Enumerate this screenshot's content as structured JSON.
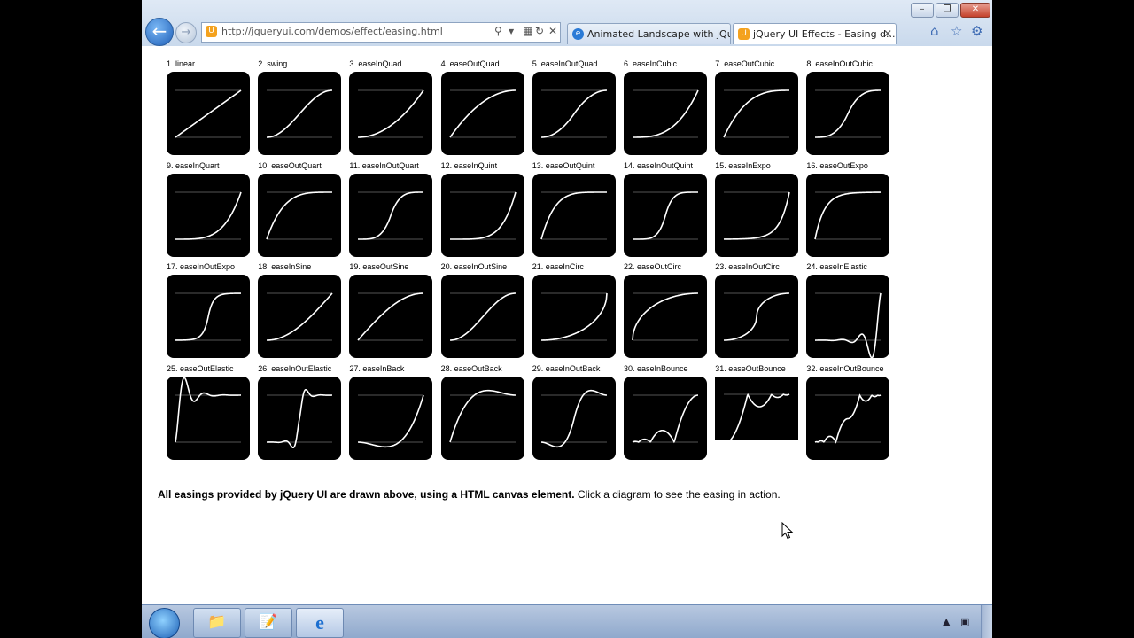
{
  "browser": {
    "address_url": "http://jqueryui.com/demos/effect/easing.html",
    "tabs": [
      {
        "label": "Animated Landscape with jQu..."
      },
      {
        "label": "jQuery UI Effects - Easing d..."
      }
    ]
  },
  "easings": [
    {
      "label": "1. linear",
      "name": "linear"
    },
    {
      "label": "2. swing",
      "name": "swing"
    },
    {
      "label": "3. easeInQuad",
      "name": "easeInQuad"
    },
    {
      "label": "4. easeOutQuad",
      "name": "easeOutQuad"
    },
    {
      "label": "5. easeInOutQuad",
      "name": "easeInOutQuad"
    },
    {
      "label": "6. easeInCubic",
      "name": "easeInCubic"
    },
    {
      "label": "7. easeOutCubic",
      "name": "easeOutCubic"
    },
    {
      "label": "8. easeInOutCubic",
      "name": "easeInOutCubic"
    },
    {
      "label": "9. easeInQuart",
      "name": "easeInQuart"
    },
    {
      "label": "10. easeOutQuart",
      "name": "easeOutQuart"
    },
    {
      "label": "11. easeInOutQuart",
      "name": "easeInOutQuart"
    },
    {
      "label": "12. easeInQuint",
      "name": "easeInQuint"
    },
    {
      "label": "13. easeOutQuint",
      "name": "easeOutQuint"
    },
    {
      "label": "14. easeInOutQuint",
      "name": "easeInOutQuint"
    },
    {
      "label": "15. easeInExpo",
      "name": "easeInExpo"
    },
    {
      "label": "16. easeOutExpo",
      "name": "easeOutExpo"
    },
    {
      "label": "17. easeInOutExpo",
      "name": "easeInOutExpo"
    },
    {
      "label": "18. easeInSine",
      "name": "easeInSine"
    },
    {
      "label": "19. easeOutSine",
      "name": "easeOutSine"
    },
    {
      "label": "20. easeInOutSine",
      "name": "easeInOutSine"
    },
    {
      "label": "21. easeInCirc",
      "name": "easeInCirc"
    },
    {
      "label": "22. easeOutCirc",
      "name": "easeOutCirc"
    },
    {
      "label": "23. easeInOutCirc",
      "name": "easeInOutCirc"
    },
    {
      "label": "24. easeInElastic",
      "name": "easeInElastic"
    },
    {
      "label": "25. easeOutElastic",
      "name": "easeOutElastic"
    },
    {
      "label": "26. easeInOutElastic",
      "name": "easeInOutElastic"
    },
    {
      "label": "27. easeInBack",
      "name": "easeInBack"
    },
    {
      "label": "28. easeOutBack",
      "name": "easeOutBack"
    },
    {
      "label": "29. easeInOutBack",
      "name": "easeInOutBack"
    },
    {
      "label": "30. easeInBounce",
      "name": "easeInBounce"
    },
    {
      "label": "31. easeOutBounce",
      "name": "easeOutBounce"
    },
    {
      "label": "32. easeInOutBounce",
      "name": "easeInOutBounce"
    }
  ],
  "caption": {
    "bold": "All easings provided by jQuery UI are drawn above, using a HTML canvas element.",
    "normal": " Click a diagram to see the easing in action."
  },
  "colors": {
    "diagram_bg": "#000000",
    "curve": "#ffffff",
    "guide_line": "#555555"
  },
  "icons": {
    "back": "back-arrow-icon",
    "forward": "forward-arrow-icon",
    "search": "search-icon",
    "refresh": "refresh-icon",
    "stop": "stop-icon",
    "home": "home-icon",
    "favorites": "star-icon",
    "tools": "gear-icon"
  }
}
